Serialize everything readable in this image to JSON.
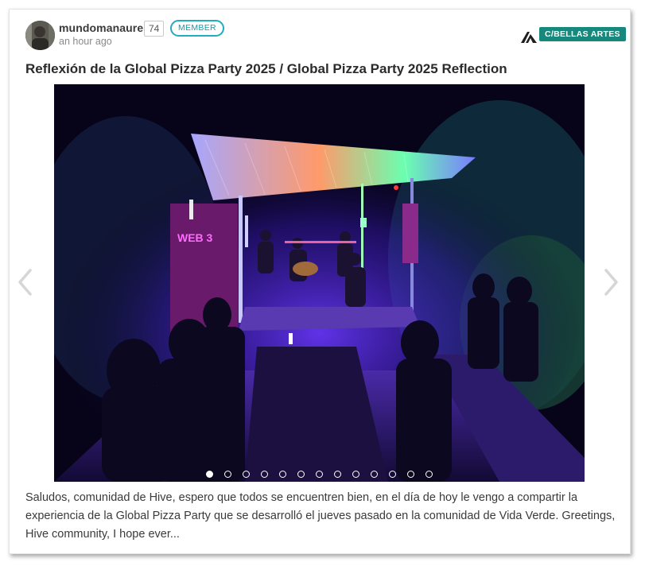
{
  "post": {
    "author": {
      "username": "mundomanaure",
      "reputation": "74",
      "role_badge": "MEMBER",
      "time_ago": "an hour ago"
    },
    "community": {
      "label": "C/BELLAS ARTES",
      "icon": "hive-logo-icon",
      "color": "#17897c"
    },
    "title": "Reflexión de la Global Pizza Party 2025 / Global Pizza Party 2025 Reflection",
    "carousel": {
      "image_alt": "Night concert under a lit corrugated roof stage with purple and blue lights",
      "total_slides": 13,
      "active_slide": 1,
      "prev_icon": "chevron-left-icon",
      "next_icon": "chevron-right-icon"
    },
    "excerpt": "Saludos, comunidad de Hive, espero que todos se encuentren bien, en el día de hoy le vengo a compartir la experiencia de la Global Pizza Party que se desarrolló el jueves pasado en la comunidad de Vida Verde. Greetings, Hive community, I hope ever..."
  },
  "colors": {
    "member_badge": "#24aac1",
    "community_badge": "#17897c",
    "text": "#3a3a3a",
    "muted": "#8a8a8a"
  }
}
